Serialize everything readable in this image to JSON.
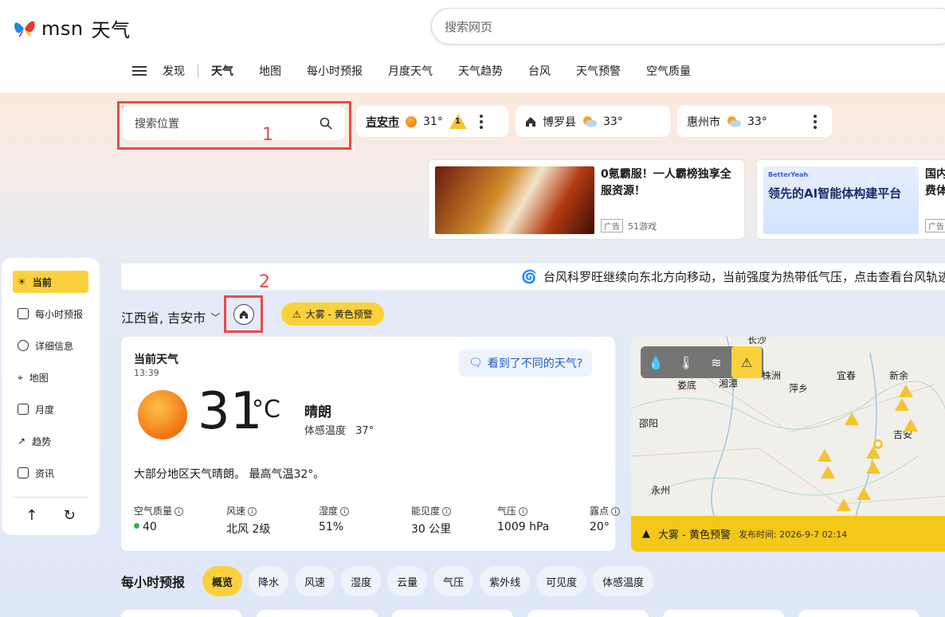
{
  "header": {
    "brand": "msn",
    "section": "天气",
    "search_placeholder": "搜索网页"
  },
  "nav": {
    "items": [
      "发现",
      "天气",
      "地图",
      "每小时预报",
      "月度天气",
      "天气趋势",
      "台风",
      "天气预警",
      "空气质量"
    ],
    "active": "天气"
  },
  "location_search": {
    "placeholder": "搜索位置",
    "annotation": "1"
  },
  "saved_locations": [
    {
      "name": "吉安市",
      "temp": "31°",
      "alert_count": "1"
    },
    {
      "name": "博罗县",
      "temp": "33°"
    },
    {
      "name": "惠州市",
      "temp": "33°"
    }
  ],
  "ads": [
    {
      "title": "0氪霸服！一人霸榜独享全服资源！",
      "tag": "广告",
      "source": "51游戏"
    },
    {
      "title": "国内",
      "title2": "费体",
      "tag": "广告",
      "image_text": "领先的AI智能体构建平台",
      "image_brand": "BetterYeah"
    }
  ],
  "sidebar": {
    "items": [
      "当前",
      "每小时预报",
      "详细信息",
      "地图",
      "月度",
      "趋势",
      "资讯"
    ],
    "active": "当前"
  },
  "banner": {
    "text": "台风科罗旺继续向东北方向移动，当前强度为热带低气压，点击查看台风轨迹"
  },
  "location": {
    "name": "江西省, 吉安市",
    "annotation": "2"
  },
  "alert": {
    "text": "大雾 - 黄色预警",
    "color": "#fbd13b"
  },
  "current": {
    "title": "当前天气",
    "time": "13:39",
    "feedback": "看到了不同的天气?",
    "temp": "31",
    "unit": "°C",
    "condition": "晴朗",
    "feels_label": "体感温度",
    "feels_value": "37°",
    "summary": "大部分地区天气晴朗。 最高气温32°。",
    "metrics": [
      {
        "label": "空气质量",
        "value": "40"
      },
      {
        "label": "风速",
        "value": "北风 2级"
      },
      {
        "label": "湿度",
        "value": "51%"
      },
      {
        "label": "能见度",
        "value": "30 公里"
      },
      {
        "label": "气压",
        "value": "1009 hPa"
      },
      {
        "label": "露点",
        "value": "20°"
      }
    ]
  },
  "map": {
    "cities": [
      "长沙",
      "娄底",
      "湘潭",
      "株洲",
      "萍乡",
      "宜春",
      "新余",
      "邵阳",
      "吉安",
      "永州"
    ],
    "alert_text": "大雾 - 黄色预警",
    "published": "发布时间: 2026-9-7 02:14"
  },
  "hourly": {
    "title": "每小时预报",
    "chips": [
      "概览",
      "降水",
      "风速",
      "湿度",
      "云量",
      "气压",
      "紫外线",
      "可见度",
      "体感温度"
    ],
    "active": "概览"
  }
}
